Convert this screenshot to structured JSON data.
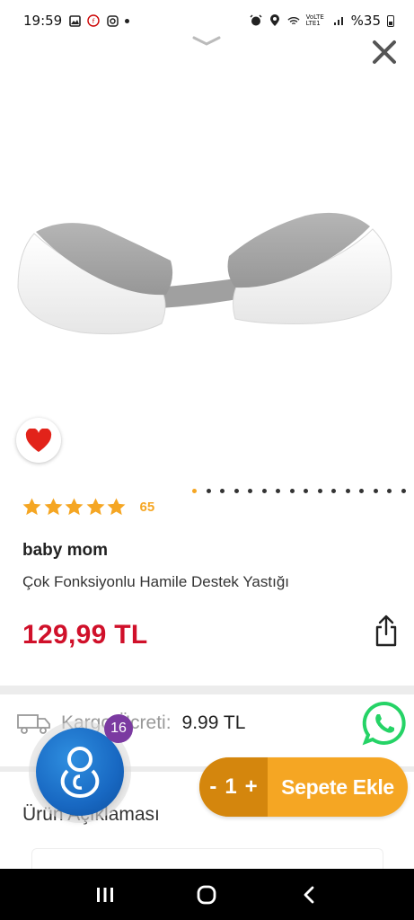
{
  "status_bar": {
    "time": "19:59",
    "network": "VoLTE LTE1",
    "battery": "%35",
    "icons": [
      "gallery-icon",
      "app-notification-icon",
      "instagram-icon",
      "dot-icon",
      "alarm-icon",
      "location-icon",
      "wifi-icon",
      "signal-icon",
      "battery-icon"
    ]
  },
  "product": {
    "rating_count": "65",
    "brand": "baby mom",
    "title": "Çok Fonksiyonlu Hamile Destek Yastığı",
    "price": "129,99 TL",
    "carousel": {
      "total": 16,
      "active_index": 0
    }
  },
  "shipping": {
    "label": "Kargo Ücreti:",
    "value": "9.99 TL"
  },
  "description": {
    "heading": "Ürün Açıklaması"
  },
  "app_bubble": {
    "badge_count": "16"
  },
  "cart": {
    "minus": "-",
    "quantity": "1",
    "plus": "+",
    "add_label": "Sepete Ekle"
  },
  "colors": {
    "accent": "#f5a623",
    "accent_dark": "#d4860d",
    "price": "#d0102a",
    "whatsapp": "#25d366",
    "badge": "#7b3aa1"
  }
}
